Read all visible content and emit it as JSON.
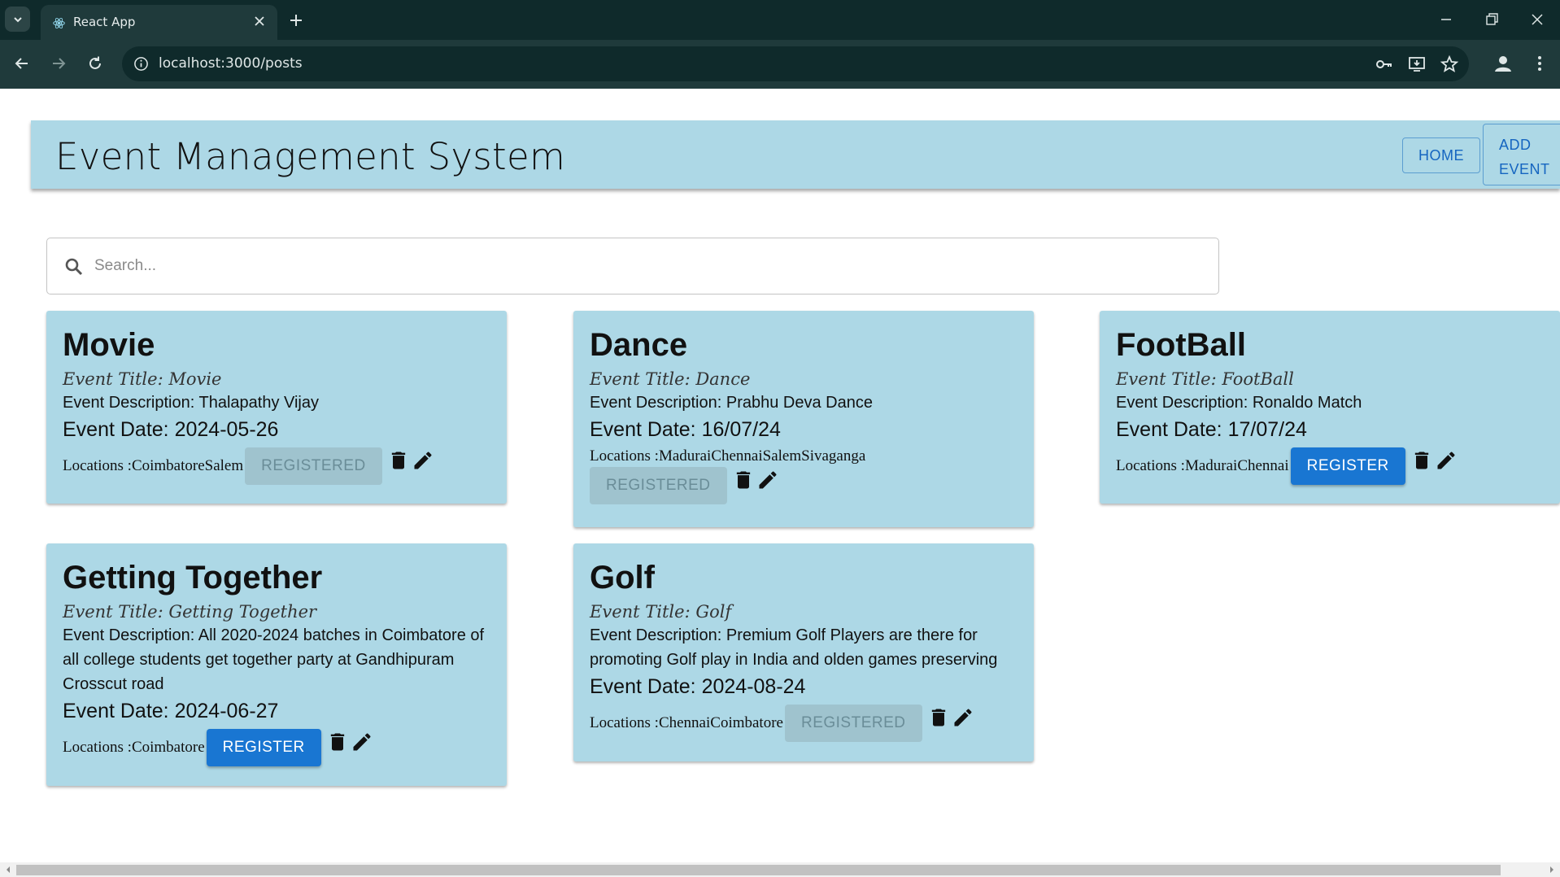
{
  "browser": {
    "tab_title": "React App",
    "url": "localhost:3000/posts"
  },
  "app": {
    "title": "Event Management System",
    "nav": {
      "home": "HOME",
      "add_line1": "ADD",
      "add_line2": "EVENT"
    },
    "search_placeholder": "Search..."
  },
  "cards": [
    {
      "heading": "Movie",
      "title_line": "Event Title: Movie",
      "desc": "Event Description: Thalapathy Vijay",
      "date": "Event Date: 2024-05-26",
      "locations": "Locations :CoimbatoreSalem",
      "button": "REGISTERED",
      "registered": true
    },
    {
      "heading": "Dance",
      "title_line": "Event Title: Dance",
      "desc": "Event Description: Prabhu Deva Dance",
      "date": "Event Date: 16/07/24",
      "locations": "Locations :MaduraiChennaiSalemSivaganga",
      "button": "REGISTERED",
      "registered": true
    },
    {
      "heading": "FootBall",
      "title_line": "Event Title: FootBall",
      "desc": "Event Description: Ronaldo Match",
      "date": "Event Date: 17/07/24",
      "locations": "Locations :MaduraiChennai",
      "button": "REGISTER",
      "registered": false
    },
    {
      "heading": "Getting Together",
      "title_line": "Event Title: Getting Together",
      "desc": "Event Description: All 2020-2024 batches in Coimbatore of all college students get together party at Gandhipuram Crosscut road",
      "date": "Event Date: 2024-06-27",
      "locations": "Locations :Coimbatore",
      "button": "REGISTER",
      "registered": false
    },
    {
      "heading": "Golf",
      "title_line": "Event Title: Golf",
      "desc": "Event Description: Premium Golf Players are there for promoting Golf play in India and olden games preserving",
      "date": "Event Date: 2024-08-24",
      "locations": "Locations :ChennaiCoimbatore",
      "button": "REGISTERED",
      "registered": true
    }
  ]
}
